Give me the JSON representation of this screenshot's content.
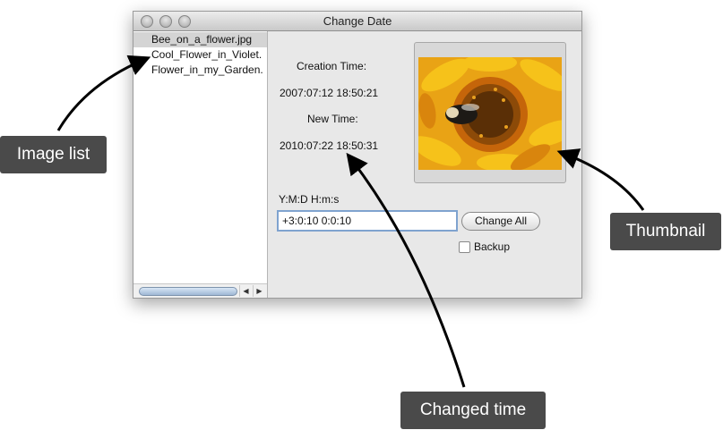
{
  "window": {
    "title": "Change Date"
  },
  "list": {
    "items": [
      {
        "label": "Bee_on_a_flower.jpg",
        "selected": true
      },
      {
        "label": "Cool_Flower_in_Violet.",
        "selected": false
      },
      {
        "label": "Flower_in_my_Garden.",
        "selected": false
      }
    ]
  },
  "details": {
    "creation_label": "Creation Time:",
    "creation_value": "2007:07:12 18:50:21",
    "new_label": "New Time:",
    "new_value": "2010:07:22 18:50:31",
    "format_label": "Y:M:D H:m:s",
    "offset_value": "+3:0:10 0:0:10",
    "change_all_label": "Change All",
    "backup_label": "Backup",
    "backup_checked": false
  },
  "callouts": {
    "image_list": "Image list",
    "thumbnail": "Thumbnail",
    "changed_time": "Changed time"
  },
  "colors": {
    "callout_bg": "#4a4a4a",
    "selection": "#d4d4d4",
    "focus_ring": "#7fa3cf"
  }
}
